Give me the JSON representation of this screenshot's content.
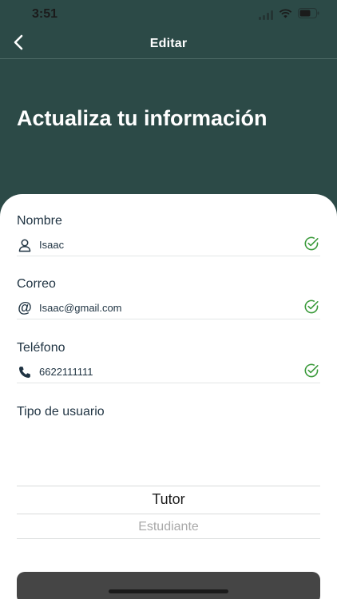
{
  "status_bar": {
    "time": "3:51",
    "icons": [
      "cellular-signal-icon",
      "wifi-icon",
      "battery-icon"
    ]
  },
  "nav": {
    "back_icon": "chevron-left-icon",
    "title": "Editar"
  },
  "header": {
    "heading": "Actualiza tu información"
  },
  "form": {
    "nombre": {
      "label": "Nombre",
      "value": "Isaac",
      "icon": "user-icon",
      "valid_icon": "check-circle-icon"
    },
    "correo": {
      "label": "Correo",
      "value": "Isaac@gmail.com",
      "icon": "at-icon",
      "valid_icon": "check-circle-icon"
    },
    "telefono": {
      "label": "Teléfono",
      "value": "6622111111",
      "icon": "phone-icon",
      "valid_icon": "check-circle-icon"
    },
    "tipo_usuario": {
      "label": "Tipo de usuario",
      "options": [
        "Tutor",
        "Estudiante"
      ],
      "selected": "Tutor"
    }
  },
  "colors": {
    "header_bg": "#2c4a47",
    "valid_green": "#3a9a3a",
    "text_dark": "#1f3342"
  }
}
